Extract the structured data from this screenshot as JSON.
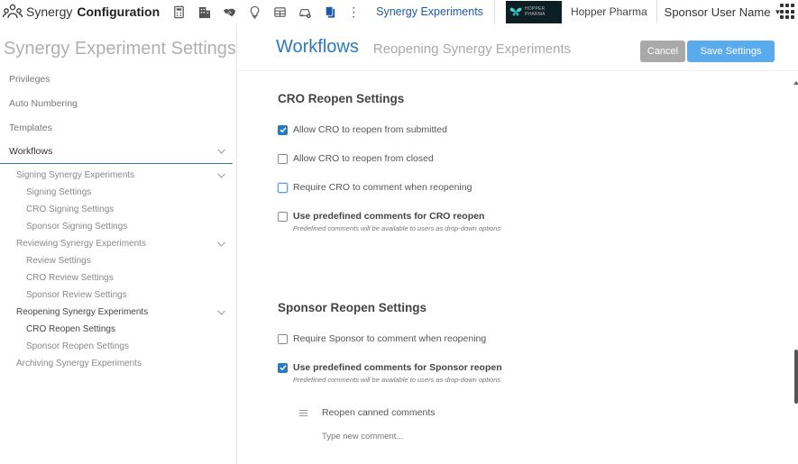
{
  "topbar": {
    "app_name": "Synergy",
    "section": "Configuration",
    "breadcrumb": "Synergy Experiments",
    "logo_text": "HOPPER PHARMA",
    "company": "Hopper Pharma",
    "user": "Sponsor User Name",
    "tool_icons": [
      "calculator-icon",
      "building-icon",
      "handshake-icon",
      "lightbulb-icon",
      "table-icon",
      "car-settings-icon",
      "copy-icon"
    ]
  },
  "sidebar": {
    "title": "Synergy Experiment Settings",
    "items": [
      {
        "label": "Privileges"
      },
      {
        "label": "Auto Numbering"
      },
      {
        "label": "Templates"
      },
      {
        "label": "Workflows"
      }
    ],
    "workflow_groups": [
      {
        "label": "Signing Synergy Experiments",
        "children": [
          "Signing Settings",
          "CRO Signing Settings",
          "Sponsor Signing Settings"
        ]
      },
      {
        "label": "Reviewing Synergy Experiments",
        "children": [
          "Review Settings",
          "CRO Review Settings",
          "Sponsor Review Settings"
        ]
      },
      {
        "label": "Reopening Synergy Experiments",
        "children": [
          "CRO Reopen Settings",
          "Sponsor Reopen Settings"
        ]
      },
      {
        "label": "Archiving Synergy Experiments",
        "children": []
      }
    ]
  },
  "main": {
    "title": "Workflows",
    "subtitle": "Reopening Synergy Experiments",
    "cancel_label": "Cancel",
    "save_label": "Save Settings",
    "cro": {
      "title": "CRO Reopen Settings",
      "opt1": "Allow CRO to reopen from submitted",
      "opt2": "Allow CRO to reopen from closed",
      "opt3": "Require CRO to comment when reopening",
      "opt4": "Use predefined comments for CRO reopen",
      "opt4_hint": "Predefined comments will be available to users as drop-down options",
      "opt1_checked": true,
      "opt2_checked": false,
      "opt3_checked": false,
      "opt4_checked": false
    },
    "sponsor": {
      "title": "Sponsor Reopen Settings",
      "opt1": "Require Sponsor to comment when reopening",
      "opt2": "Use predefined comments for Sponsor reopen",
      "opt2_hint": "Predefined comments will be available to users as drop-down options",
      "opt1_checked": false,
      "opt2_checked": true,
      "canned_comment": "Reopen canned comments",
      "new_comment_placeholder": "Type new comment..."
    }
  },
  "colors": {
    "accent": "#2a7ac0",
    "save_button": "#5aabee",
    "cancel_button": "#a9a9a9",
    "active_underline": "#357a81"
  }
}
